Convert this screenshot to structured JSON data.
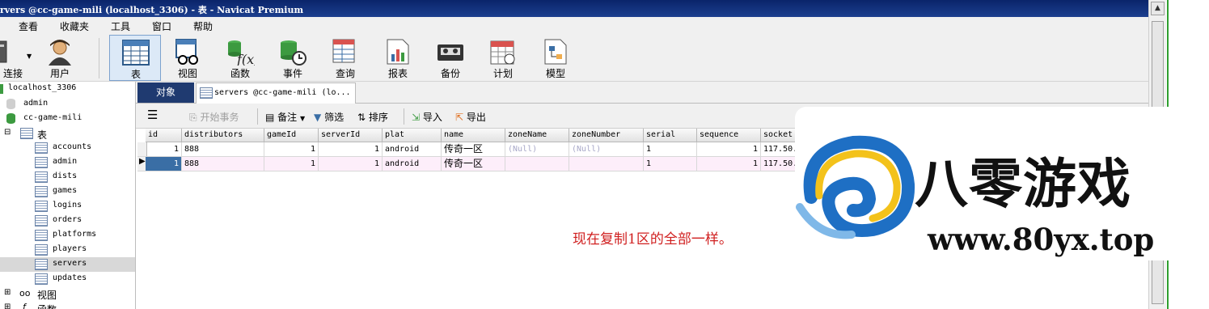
{
  "window": {
    "title": "rvers @cc-game-mili (localhost_3306) - 表 - Navicat Premium"
  },
  "menu": [
    "查看",
    "收藏夹",
    "工具",
    "窗口",
    "帮助"
  ],
  "toolbar": {
    "connect": "连接",
    "user": "用户",
    "table": "表",
    "view": "视图",
    "function": "函数",
    "event": "事件",
    "query": "查询",
    "report": "报表",
    "backup": "备份",
    "schedule": "计划",
    "model": "模型"
  },
  "sidebar": {
    "connection": "localhost_3306",
    "db_admin": "admin",
    "db_current": "cc-game-mili",
    "tables_group": "表",
    "tables": [
      "accounts",
      "admin",
      "dists",
      "games",
      "logins",
      "orders",
      "platforms",
      "players",
      "servers",
      "updates"
    ],
    "selected": "servers",
    "views_group": "视图",
    "functions_group": "函数"
  },
  "tabs": {
    "objects": "对象",
    "current": "servers @cc-game-mili (lo..."
  },
  "gridtools": {
    "begin_tx": "开始事务",
    "memo": "备注",
    "filter": "筛选",
    "sort": "排序",
    "import": "导入",
    "export": "导出"
  },
  "grid": {
    "columns": [
      "id",
      "distributors",
      "gameId",
      "serverId",
      "plat",
      "name",
      "zoneName",
      "zoneNumber",
      "serial",
      "sequence",
      "socket"
    ],
    "rows": [
      [
        "1",
        "888",
        "1",
        "1",
        "android",
        "传奇一区",
        "(Null)",
        "(Null)",
        "1",
        "1",
        "117.50."
      ],
      [
        "1",
        "888",
        "1",
        "1",
        "android",
        "传奇一区",
        "",
        "",
        "1",
        "1",
        "117.50."
      ]
    ]
  },
  "note": "现在复制1区的全部一样。",
  "watermark": {
    "name": "八零游戏",
    "url": "www.80yx.top"
  }
}
